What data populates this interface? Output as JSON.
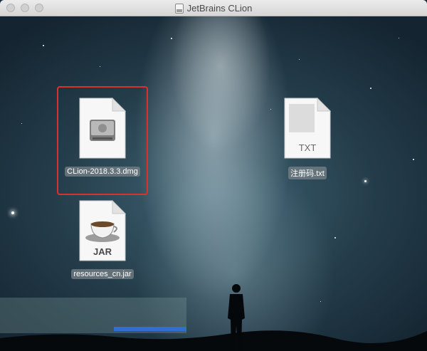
{
  "window": {
    "title": "JetBrains CLion",
    "title_icon": "disk-image-icon"
  },
  "files": [
    {
      "name": "CLion-2018.3.3.dmg",
      "icon": "dmg-disk-icon",
      "selected": true
    },
    {
      "name": "注册码.txt",
      "icon": "txt-file-icon",
      "badge": "TXT"
    },
    {
      "name": "resources_cn.jar",
      "icon": "jar-coffee-icon",
      "badge": "JAR"
    }
  ],
  "colors": {
    "selection": "#d9312b",
    "glitch_bar": "#2e6fd0"
  }
}
